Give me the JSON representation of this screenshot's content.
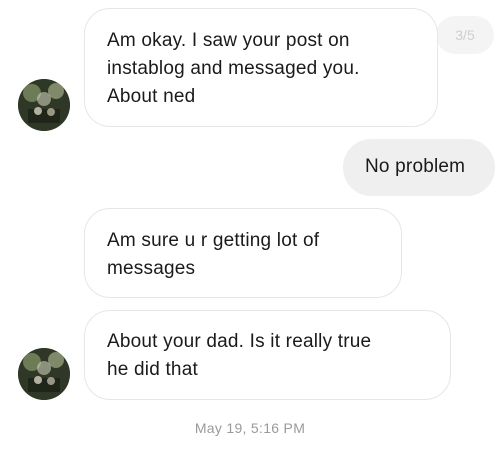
{
  "thread": {
    "page_indicator": "3/5",
    "messages": [
      {
        "sender": "other",
        "text": "Am okay. I saw your post on\ninstablog and messaged you.\nAbout ned"
      },
      {
        "sender": "me",
        "text": "No problem"
      },
      {
        "sender": "other",
        "text": "Am sure u r getting lot of\nmessages"
      },
      {
        "sender": "other",
        "text": "About your dad. Is it really true\nhe did that"
      }
    ],
    "timestamp": "May 19, 5:16 PM"
  },
  "colors": {
    "incoming_bubble_bg": "#ffffff",
    "incoming_bubble_border": "#e6e6e6",
    "outgoing_bubble_bg": "#efefef",
    "timestamp_text": "#9a9a9a"
  }
}
